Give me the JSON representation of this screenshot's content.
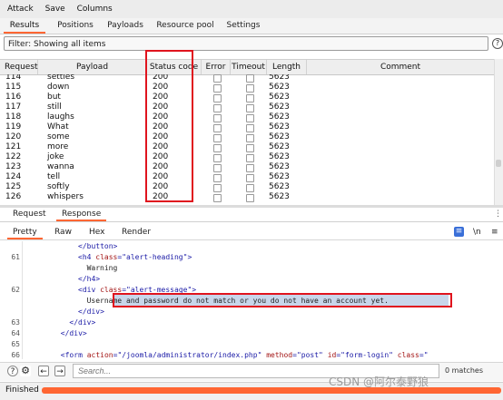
{
  "menu": [
    "Attack",
    "Save",
    "Columns"
  ],
  "tabs": [
    {
      "label": "Results",
      "active": true
    },
    {
      "label": "Positions",
      "active": false
    },
    {
      "label": "Payloads",
      "active": false
    },
    {
      "label": "Resource pool",
      "active": false
    },
    {
      "label": "Settings",
      "active": false
    }
  ],
  "filter": {
    "label": "Filter: Showing all items"
  },
  "table": {
    "columns": [
      "Request",
      "Payload",
      "Status code",
      "Error",
      "Timeout",
      "Length",
      "Comment"
    ],
    "rows": [
      {
        "request": "114",
        "payload": "settles",
        "status": "200",
        "length": "5623"
      },
      {
        "request": "115",
        "payload": "down",
        "status": "200",
        "length": "5623"
      },
      {
        "request": "116",
        "payload": "but",
        "status": "200",
        "length": "5623"
      },
      {
        "request": "117",
        "payload": "still",
        "status": "200",
        "length": "5623"
      },
      {
        "request": "118",
        "payload": "laughs",
        "status": "200",
        "length": "5623"
      },
      {
        "request": "119",
        "payload": "What",
        "status": "200",
        "length": "5623"
      },
      {
        "request": "120",
        "payload": "some",
        "status": "200",
        "length": "5623"
      },
      {
        "request": "121",
        "payload": "more",
        "status": "200",
        "length": "5623"
      },
      {
        "request": "122",
        "payload": "joke",
        "status": "200",
        "length": "5623"
      },
      {
        "request": "123",
        "payload": "wanna",
        "status": "200",
        "length": "5623"
      },
      {
        "request": "124",
        "payload": "tell",
        "status": "200",
        "length": "5623"
      },
      {
        "request": "125",
        "payload": "softly",
        "status": "200",
        "length": "5623"
      },
      {
        "request": "126",
        "payload": "whispers",
        "status": "200",
        "length": "5623"
      }
    ]
  },
  "reqres_tabs": [
    {
      "label": "Request",
      "active": false
    },
    {
      "label": "Response",
      "active": true
    }
  ],
  "view_tabs": [
    {
      "label": "Pretty",
      "active": true
    },
    {
      "label": "Raw",
      "active": false
    },
    {
      "label": "Hex",
      "active": false
    },
    {
      "label": "Render",
      "active": false
    }
  ],
  "view_icons": {
    "wrap": "≡",
    "newline": "\\n",
    "menu": "≡"
  },
  "code_lines": [
    {
      "num": "",
      "indent": 10,
      "parts": [
        [
          "tag",
          "</button>"
        ]
      ]
    },
    {
      "num": "61",
      "indent": 10,
      "parts": [
        [
          "tag",
          "<h4 "
        ],
        [
          "attr",
          "class"
        ],
        [
          "tag",
          "="
        ],
        [
          "val",
          "\"alert-heading\""
        ],
        [
          "tag",
          ">"
        ]
      ]
    },
    {
      "num": "",
      "indent": 12,
      "parts": [
        [
          "plain",
          "Warning"
        ]
      ]
    },
    {
      "num": "",
      "indent": 10,
      "parts": [
        [
          "tag",
          "</h4>"
        ]
      ]
    },
    {
      "num": "62",
      "indent": 10,
      "parts": [
        [
          "tag",
          "<div "
        ],
        [
          "attr",
          "class"
        ],
        [
          "tag",
          "="
        ],
        [
          "val",
          "\"alert-message\""
        ],
        [
          "tag",
          ">"
        ]
      ]
    },
    {
      "num": "",
      "indent": 12,
      "parts": [
        [
          "plain",
          "Username and password do not match or you do not have an account yet."
        ]
      ]
    },
    {
      "num": "",
      "indent": 10,
      "parts": [
        [
          "tag",
          "</div>"
        ]
      ]
    },
    {
      "num": "63",
      "indent": 8,
      "parts": [
        [
          "tag",
          "</div>"
        ]
      ]
    },
    {
      "num": "64",
      "indent": 6,
      "parts": [
        [
          "tag",
          "</div>"
        ]
      ]
    },
    {
      "num": "65",
      "indent": 0,
      "parts": []
    },
    {
      "num": "66",
      "indent": 6,
      "parts": [
        [
          "tag",
          "<form "
        ],
        [
          "attr",
          "action"
        ],
        [
          "tag",
          "="
        ],
        [
          "val",
          "\"/joomla/administrator/index.php\""
        ],
        [
          "tag",
          " "
        ],
        [
          "attr",
          "method"
        ],
        [
          "tag",
          "="
        ],
        [
          "val",
          "\"post\""
        ],
        [
          "tag",
          " "
        ],
        [
          "attr",
          "id"
        ],
        [
          "tag",
          "="
        ],
        [
          "val",
          "\"form-login\""
        ],
        [
          "tag",
          " "
        ],
        [
          "attr",
          "class"
        ],
        [
          "tag",
          "=\""
        ]
      ]
    }
  ],
  "search": {
    "placeholder": "Search...",
    "matches": "0 matches"
  },
  "status": {
    "label": "Finished",
    "progress": 1.0
  },
  "watermark": "CSDN @阿尔泰野狼",
  "colors": {
    "accent": "#ff6633",
    "highlight": "#e0141e",
    "selection": "#c8d6ea"
  }
}
